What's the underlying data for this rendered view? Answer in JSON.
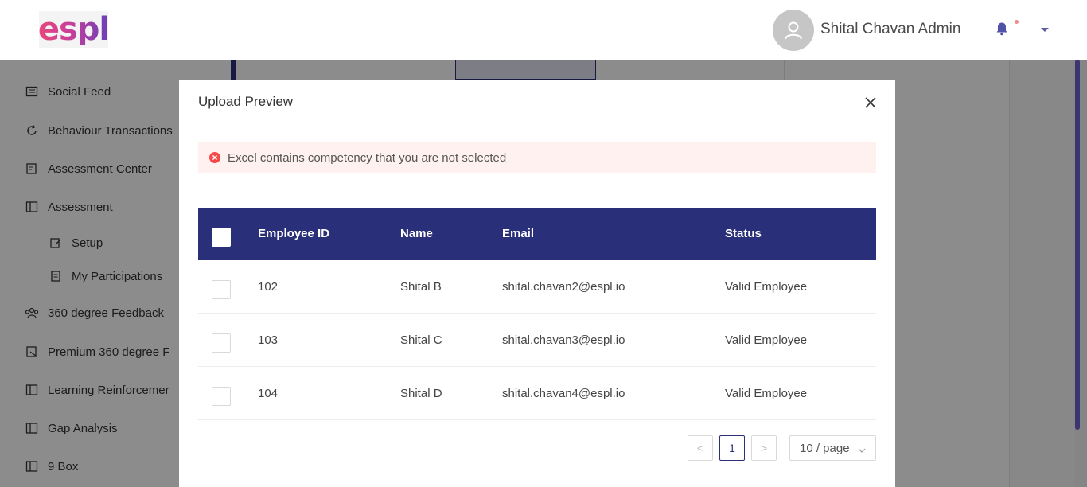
{
  "header": {
    "logo_text": "espl",
    "user_name": "Shital Chavan Admin",
    "accent_color": "#2a2f7a"
  },
  "sidebar": {
    "items": [
      {
        "label": "Social Feed",
        "icon": "newspaper-icon"
      },
      {
        "label": "Behaviour Transactions",
        "icon": "refresh-icon"
      },
      {
        "label": "Assessment Center",
        "icon": "edit-doc-icon"
      },
      {
        "label": "Assessment",
        "icon": "book-icon"
      },
      {
        "label": "Setup",
        "icon": "setup-icon"
      },
      {
        "label": "My Participations",
        "icon": "list-doc-icon"
      },
      {
        "label": "360 degree Feedback",
        "icon": "team-icon"
      },
      {
        "label": "Premium 360 degree F",
        "icon": "premium-icon"
      },
      {
        "label": "Learning Reinforcemer",
        "icon": "book-icon"
      },
      {
        "label": "Gap Analysis",
        "icon": "book-icon"
      },
      {
        "label": "9 Box",
        "icon": "book-icon"
      }
    ]
  },
  "modal": {
    "title": "Upload Preview",
    "alert": "Excel contains competency that you are not selected",
    "columns": [
      "Employee ID",
      "Name",
      "Email",
      "Status"
    ],
    "rows": [
      {
        "id": "102",
        "name": "Shital B",
        "email": "shital.chavan2@espl.io",
        "status": "Valid Employee"
      },
      {
        "id": "103",
        "name": "Shital C",
        "email": "shital.chavan3@espl.io",
        "status": "Valid Employee"
      },
      {
        "id": "104",
        "name": "Shital D",
        "email": "shital.chavan4@espl.io",
        "status": "Valid Employee"
      }
    ],
    "pagination": {
      "prev": "<",
      "current": "1",
      "next": ">",
      "page_size": "10 / page"
    }
  }
}
